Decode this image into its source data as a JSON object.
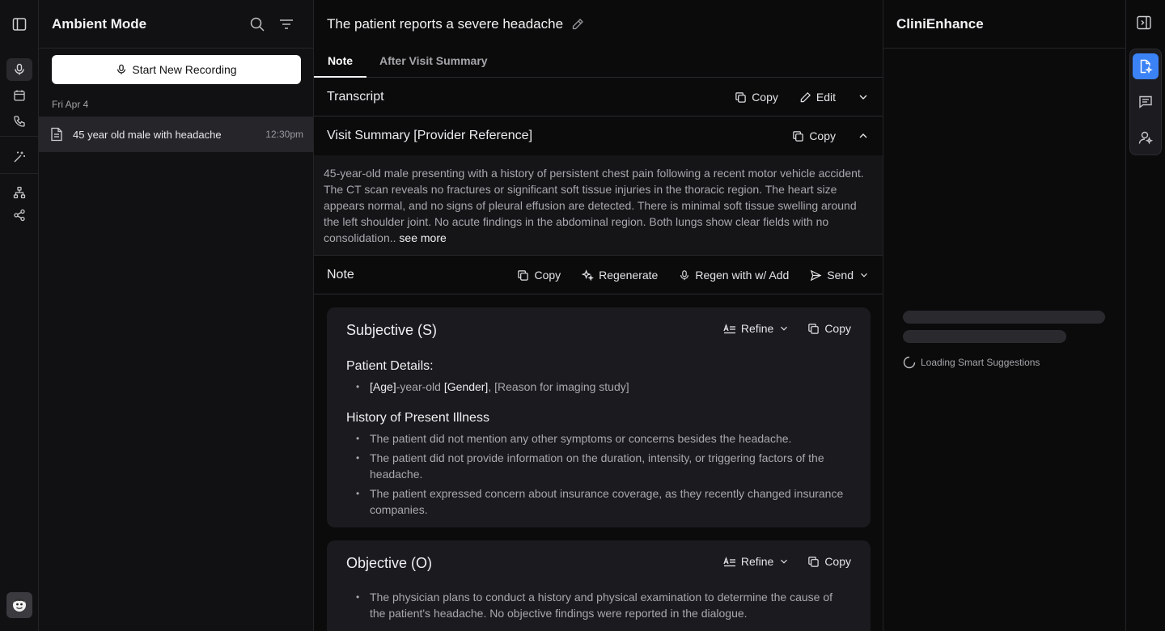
{
  "sidebar": {
    "title": "Ambient Mode",
    "record_label": "Start New Recording",
    "date_label": "Fri Apr 4",
    "recordings": [
      {
        "name": "45 year old male with headache",
        "time": "12:30pm"
      }
    ]
  },
  "main": {
    "title": "The patient reports a severe headache",
    "tabs": [
      {
        "label": "Note",
        "active": true
      },
      {
        "label": "After Visit Summary",
        "active": false
      }
    ],
    "transcript": {
      "label": "Transcript",
      "copy": "Copy",
      "edit": "Edit"
    },
    "visit_summary": {
      "label": "Visit Summary [Provider Reference]",
      "copy": "Copy",
      "text": "45-year-old male presenting with a history of persistent chest pain following a recent motor vehicle accident. The CT scan reveals no fractures or significant soft tissue injuries in the thoracic region. The heart size appears normal, and no signs of pleural effusion are detected. There is minimal soft tissue swelling around the left shoulder joint. No acute findings in the abdominal region. Both lungs show clear fields with no consolidation..",
      "see_more": "see more"
    },
    "note": {
      "label": "Note",
      "copy": "Copy",
      "regenerate": "Regenerate",
      "regen_add": "Regen with w/ Add",
      "send": "Send"
    },
    "subjective": {
      "title": "Subjective (S)",
      "refine": "Refine",
      "copy": "Copy",
      "patient_details_heading": "Patient Details:",
      "patient_age": "[Age]",
      "patient_mid": "-year-old ",
      "patient_gender": "[Gender]",
      "patient_reason": ", [Reason for imaging study]",
      "hpi_heading": "History of Present Illness",
      "hpi": [
        "The patient did not mention any other symptoms or concerns besides the headache.",
        "The patient did not provide information on the duration, intensity, or triggering factors of the headache.",
        "The patient expressed concern about insurance coverage, as they recently changed insurance companies."
      ]
    },
    "objective": {
      "title": "Objective (O)",
      "refine": "Refine",
      "copy": "Copy",
      "items": [
        "The physician plans to conduct a history and physical examination to determine the cause of the patient's headache. No objective findings were reported in the dialogue."
      ]
    }
  },
  "right_panel": {
    "title": "CliniEnhance",
    "loading_text": "Loading Smart Suggestions"
  },
  "colors": {
    "accent": "#3b82f6",
    "background": "#0b0b0c",
    "panel": "#111113",
    "card": "#1b1b1f"
  }
}
